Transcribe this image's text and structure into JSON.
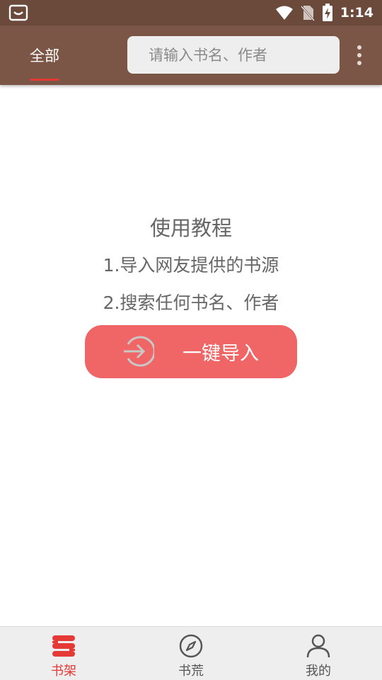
{
  "status_bar": {
    "time": "1:14",
    "icons": [
      "shop-bag-icon",
      "wifi-icon",
      "no-sim-icon",
      "battery-charging-icon"
    ]
  },
  "header": {
    "tab_label": "全部",
    "search_placeholder": "请输入书名、作者",
    "menu_icon": "more-vertical-icon"
  },
  "tutorial": {
    "title": "使用教程",
    "step1": "1.导入网友提供的书源",
    "step2": "2.搜索任何书名、作者",
    "import_button_label": "一键导入",
    "import_icon": "import-arrow-icon"
  },
  "bottom_nav": {
    "items": [
      {
        "label": "书架",
        "icon": "bookshelf-icon",
        "active": true
      },
      {
        "label": "书荒",
        "icon": "compass-icon",
        "active": false
      },
      {
        "label": "我的",
        "icon": "person-icon",
        "active": false
      }
    ]
  },
  "colors": {
    "status_bar": "#6b4a3c",
    "top_bar": "#7b5646",
    "accent": "#e53935",
    "import_button": "#f06565"
  }
}
